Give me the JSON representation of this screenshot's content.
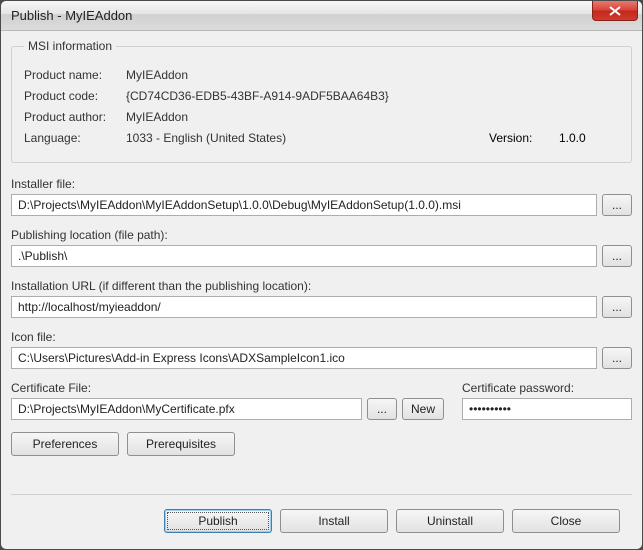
{
  "window": {
    "title": "Publish - MyIEAddon"
  },
  "msi": {
    "legend": "MSI information",
    "product_name_label": "Product name:",
    "product_name": "MyIEAddon",
    "product_code_label": "Product code:",
    "product_code": "{CD74CD36-EDB5-43BF-A914-9ADF5BAA64B3}",
    "product_author_label": "Product author:",
    "product_author": "MyIEAddon",
    "language_label": "Language:",
    "language": "1033 - English (United States)",
    "version_label": "Version:",
    "version": "1.0.0"
  },
  "fields": {
    "installer_file_label": "Installer file:",
    "installer_file": "D:\\Projects\\MyIEAddon\\MyIEAddonSetup\\1.0.0\\Debug\\MyIEAddonSetup(1.0.0).msi",
    "publishing_location_label": "Publishing location (file path):",
    "publishing_location": ".\\Publish\\",
    "installation_url_label": "Installation URL (if different than the publishing location):",
    "installation_url": "http://localhost/myieaddon/",
    "icon_file_label": "Icon file:",
    "icon_file": "C:\\Users\\Pictures\\Add-in Express Icons\\ADXSampleIcon1.ico",
    "certificate_file_label": "Certificate File:",
    "certificate_file": "D:\\Projects\\MyIEAddon\\MyCertificate.pfx",
    "certificate_password_label": "Certificate password:",
    "certificate_password": "••••••••••",
    "browse_label": "...",
    "new_label": "New"
  },
  "buttons": {
    "preferences": "Preferences",
    "prerequisites": "Prerequisites",
    "publish": "Publish",
    "install": "Install",
    "uninstall": "Uninstall",
    "close": "Close"
  }
}
